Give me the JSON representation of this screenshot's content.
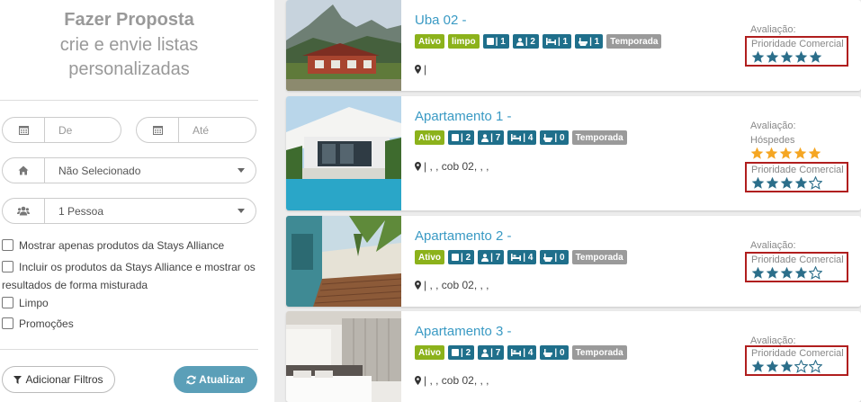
{
  "sidebar": {
    "title": "Fazer Proposta",
    "subtitle_line1": "crie e envie listas",
    "subtitle_line2": "personalizadas",
    "date_from_placeholder": "De",
    "date_to_placeholder": "Até",
    "property_select_value": "Não Selecionado",
    "guests_select_value": "1 Pessoa",
    "checkboxes": [
      {
        "label": "Mostrar apenas produtos da Stays Alliance",
        "checked": false
      },
      {
        "label": "Incluir os produtos da Stays Alliance e mostrar os resultados de forma misturada",
        "label_line1": "Incluir os produtos da Stays Alliance e mostrar os",
        "label_line2": "resultados de forma misturada",
        "checked": false
      },
      {
        "label": "Limpo",
        "checked": false
      },
      {
        "label": "Promoções",
        "checked": false
      }
    ],
    "add_filters_label": "Adicionar Filtros",
    "update_label": "Atualizar"
  },
  "listings": [
    {
      "title": "Uba 02 -",
      "badges": {
        "status": "Ativo",
        "clean": "limpo",
        "rooms": "| 1",
        "guests": "| 2",
        "beds": "| 1",
        "baths": "| 1",
        "type": "Temporada"
      },
      "address": "|",
      "evaluation_label": "Avaliação:",
      "guest_label": "",
      "guest_rating": 0,
      "priority_label": "Prioridade Comercial",
      "priority_rating": 5
    },
    {
      "title": "Apartamento 1 -",
      "badges": {
        "status": "Ativo",
        "clean": "",
        "rooms": "| 2",
        "guests": "| 7",
        "beds": "| 4",
        "baths": "| 0",
        "type": "Temporada"
      },
      "address": "| , , cob 02, , ,",
      "evaluation_label": "Avaliação:",
      "guest_label": "Hóspedes",
      "guest_rating": 5,
      "priority_label": "Prioridade Comercial",
      "priority_rating": 4
    },
    {
      "title": "Apartamento 2 -",
      "badges": {
        "status": "Ativo",
        "clean": "",
        "rooms": "| 2",
        "guests": "| 7",
        "beds": "| 4",
        "baths": "| 0",
        "type": "Temporada"
      },
      "address": "| , , cob 02, , ,",
      "evaluation_label": "Avaliação:",
      "guest_label": "",
      "guest_rating": 0,
      "priority_label": "Prioridade Comercial",
      "priority_rating": 4
    },
    {
      "title": "Apartamento 3 -",
      "badges": {
        "status": "Ativo",
        "clean": "",
        "rooms": "| 2",
        "guests": "| 7",
        "beds": "| 4",
        "baths": "| 0",
        "type": "Temporada"
      },
      "address": "| , , cob 02, , ,",
      "evaluation_label": "Avaliação:",
      "guest_label": "",
      "guest_rating": 0,
      "priority_label": "Prioridade Comercial",
      "priority_rating": 3
    }
  ],
  "colors": {
    "accent": "#3a9ac4",
    "badge_green": "#8cb21b",
    "badge_blue": "#1f6f8b",
    "badge_gray": "#9a9a9a",
    "star_blue": "#2b6e8a",
    "star_gold": "#f5a623",
    "highlight_border": "#b01e1e"
  },
  "icons": {
    "calendar": "calendar-icon",
    "home": "home-icon",
    "users": "users-icon",
    "filter": "filter-icon",
    "refresh": "refresh-icon",
    "map_marker": "map-marker-icon",
    "star": "star-icon"
  }
}
